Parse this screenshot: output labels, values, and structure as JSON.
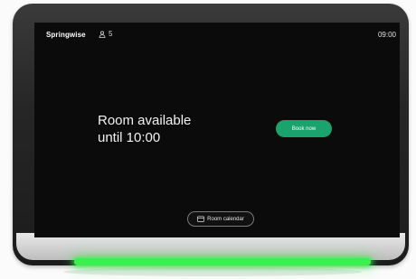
{
  "header": {
    "brand": "Springwise",
    "occupancy_icon": "person-icon",
    "occupancy_count": "5",
    "time": "09:00"
  },
  "status": {
    "line1": "Room available",
    "line2": "until 10:00"
  },
  "actions": {
    "book_label": "Book now",
    "calendar_label": "Room calendar",
    "calendar_icon": "calendar-icon"
  },
  "colors": {
    "accent": "#1aa36d",
    "led": "#3bf04c",
    "screen_bg": "#0b0b0b"
  }
}
